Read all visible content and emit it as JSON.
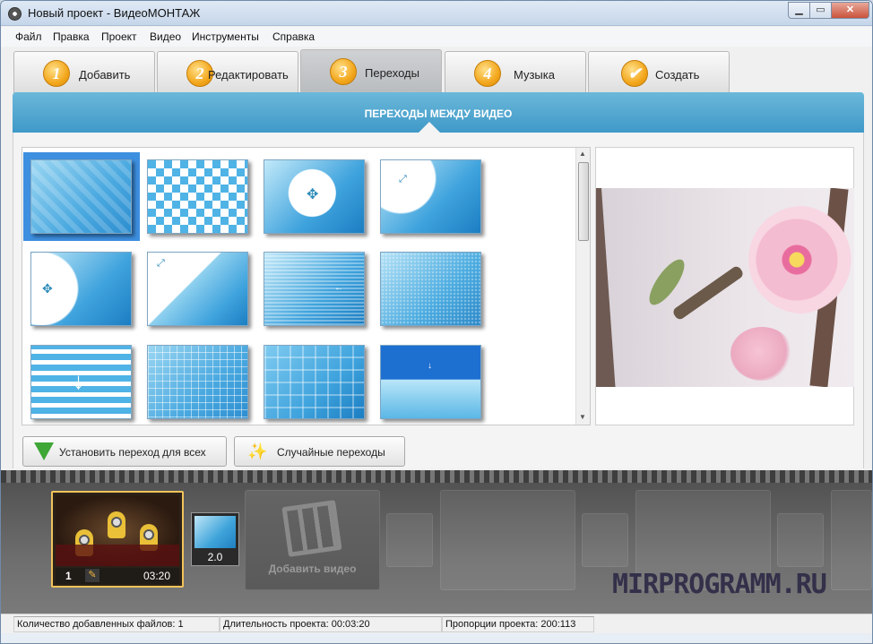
{
  "window": {
    "title": "Новый проект - ВидеоМОНТАЖ"
  },
  "menu": [
    "Файл",
    "Правка",
    "Проект",
    "Видео",
    "Инструменты",
    "Справка"
  ],
  "tabs": [
    {
      "num": "1",
      "label": "Добавить"
    },
    {
      "num": "2",
      "label": "Редактировать"
    },
    {
      "num": "3",
      "label": "Переходы",
      "active": true
    },
    {
      "num": "4",
      "label": "Музыка"
    },
    {
      "num": "✔",
      "label": "Создать"
    }
  ],
  "section": {
    "title": "ПЕРЕХОДЫ МЕЖДУ ВИДЕО"
  },
  "transitions": {
    "selected_index": 0,
    "count": 12
  },
  "buttons": {
    "apply_all": "Установить переход для всех",
    "random": "Случайные переходы"
  },
  "timeline": {
    "clip": {
      "index": "1",
      "duration": "03:20"
    },
    "transition": {
      "duration": "2.0"
    },
    "add_video_label": "Добавить видео"
  },
  "watermark": "MIRPROGRAMM.RU",
  "status": {
    "files": "Количество добавленных файлов: 1",
    "duration": "Длительность проекта:  00:03:20",
    "ratio": "Пропорции проекта:  200:113"
  },
  "colors": {
    "accent": "#3f99c8",
    "selection": "#3d8fe0",
    "clip_border": "#f1c35c"
  }
}
